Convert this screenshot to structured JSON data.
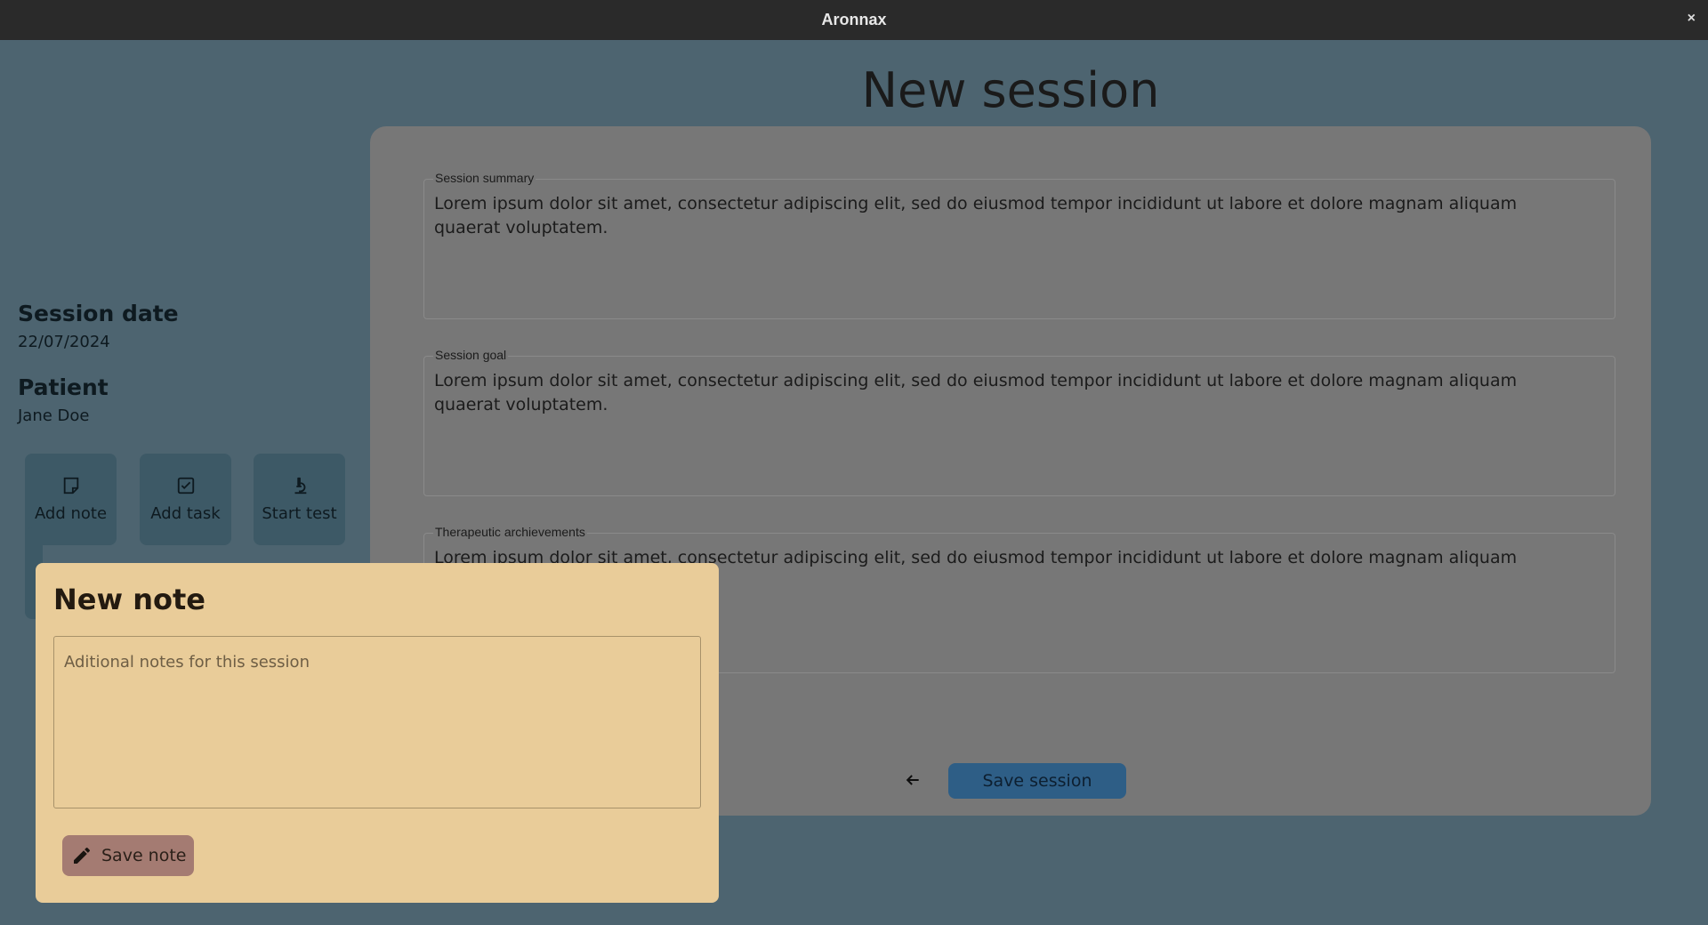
{
  "window": {
    "title": "Aronnax",
    "close_label": "×"
  },
  "page": {
    "title": "New session"
  },
  "sidebar": {
    "session_date_heading": "Session date",
    "session_date_value": "22/07/2024",
    "patient_heading": "Patient",
    "patient_value": "Jane Doe",
    "actions": [
      {
        "label": "Add note",
        "icon": "sticky-note-icon"
      },
      {
        "label": "Add task",
        "icon": "checkbox-icon"
      },
      {
        "label": "Start test",
        "icon": "microscope-icon"
      }
    ]
  },
  "form": {
    "fields": [
      {
        "label": "Session summary",
        "value": "Lorem ipsum dolor sit amet, consectetur adipiscing elit, sed do eiusmod tempor incididunt ut labore et dolore magnam aliquam quaerat voluptatem."
      },
      {
        "label": "Session goal",
        "value": "Lorem ipsum dolor sit amet, consectetur adipiscing elit, sed do eiusmod tempor incididunt ut labore et dolore magnam aliquam quaerat voluptatem."
      },
      {
        "label": "Therapeutic archievements",
        "value": "Lorem ipsum dolor sit amet, consectetur adipiscing elit, sed do eiusmod tempor incididunt ut labore et dolore magnam aliquam"
      }
    ],
    "back_icon": "arrow-left-icon",
    "save_label": "Save session"
  },
  "note_modal": {
    "title": "New note",
    "placeholder": "Aditional notes for this session",
    "value": "",
    "save_label": "Save note",
    "save_icon": "pencil-icon"
  },
  "colors": {
    "background": "#4d6470",
    "card": "#777777",
    "accent": "#2e5e86",
    "modal": "#e9cc99",
    "save_note_button": "#a47b72"
  }
}
